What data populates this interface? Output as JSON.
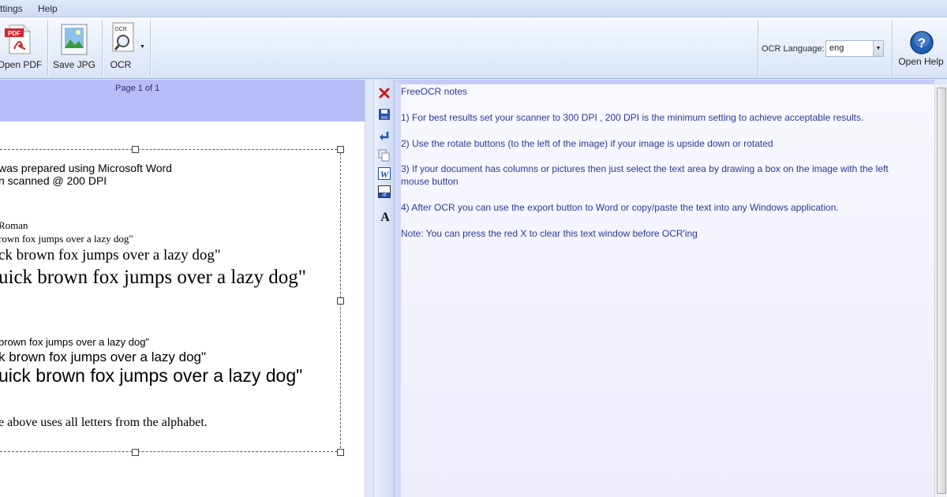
{
  "menubar": {
    "items": [
      {
        "label": "ttings"
      },
      {
        "label": "Help"
      }
    ]
  },
  "toolbar": {
    "open_pdf_label": "Open PDF",
    "pdf_badge": "PDF",
    "save_jpg_label": "Save JPG",
    "ocr_label": "OCR",
    "ocr_badge": "OCR",
    "language_label": "OCR Language:",
    "language_value": "eng",
    "open_help_label": "Open Help"
  },
  "image_pane": {
    "page_indicator": "Page 1 of 1",
    "lines": [
      "was prepared using Microsoft Word",
      "n scanned @ 200 DPI",
      "Roman",
      "rown fox jumps over a lazy dog\"",
      "ck brown fox jumps over a lazy dog\"",
      "uick brown fox jumps over a lazy dog\"",
      "brown fox jumps over a lazy dog\"",
      "k brown fox  jumps over a lazy dog\"",
      "uick brown fox jumps over a lazy dog\"",
      "e above uses all letters from the alphabet."
    ]
  },
  "text_pane": {
    "lines": [
      "FreeOCR notes",
      "1) For best results set your scanner to 300 DPI , 200 DPI is the minimum setting to achieve acceptable results.",
      "2) Use the rotate buttons (to the left of the image) if your image is upside down or rotated",
      "3) If your document has columns or pictures then just select the text area by drawing a box on the image with the left",
      "mouse button",
      "4) After OCR you can use the export button to Word or copy/paste the text into any Windows application.",
      "Note: You can press the red X to clear this text window before OCR'ing"
    ]
  },
  "side_toolbar": {
    "icons": [
      "clear-x-icon",
      "save-disk-icon",
      "return-arrow-icon",
      "copy-icon",
      "word-export-icon",
      "rtf-export-icon",
      "font-icon"
    ],
    "font_glyph": "A",
    "word_glyph": "W",
    "rtf_glyph": "rtf"
  },
  "colors": {
    "accent_red": "#cc1a1a",
    "text_blue": "#2a3a9a",
    "help_blue": "#1f5fb5",
    "left_pane_bg": "#b8bdf8"
  }
}
